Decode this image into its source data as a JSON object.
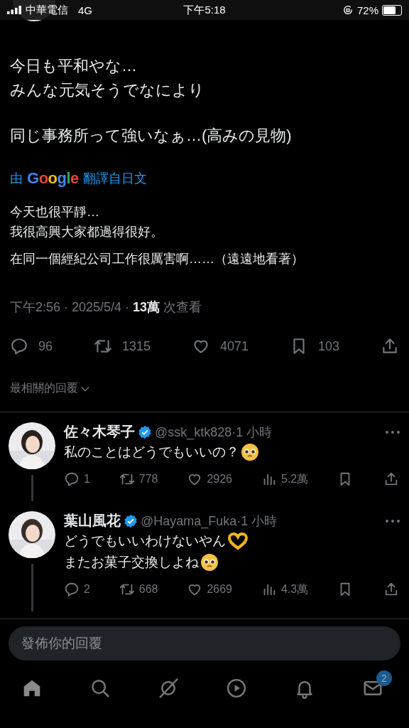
{
  "status_bar": {
    "carrier": "中華電信",
    "network": "4G",
    "time": "下午5:18",
    "battery": "72%"
  },
  "tweet": {
    "paragraphs": [
      "今日も平和やな…\nみんな元気そうでなにより",
      "同じ事務所って強いなぁ…(高みの見物)"
    ],
    "translation_prefix": "由",
    "translation_brand": "Google",
    "translation_suffix": "翻譯自日文",
    "translation_paragraphs": [
      "今天也很平靜…\n我很高興大家都過得很好。",
      "在同一個經紀公司工作很厲害啊……（遠遠地看著）"
    ],
    "meta": "下午2:56 · 2025/5/4 · **13萬** 次查看",
    "actions": [
      {
        "kind": "reply",
        "count": "96"
      },
      {
        "kind": "repost",
        "count": "1315"
      },
      {
        "kind": "like",
        "count": "4071"
      },
      {
        "kind": "bookmark",
        "count": "103"
      },
      {
        "kind": "share"
      }
    ]
  },
  "sort_label": "最相關的回覆",
  "replies": [
    {
      "name": "佐々木琴子",
      "handle_time": "@ssk_ktk828·1 小時",
      "verified": true,
      "lines": [
        [
          {
            "kind": "text",
            "text": "私のことはどうでもいいの？"
          },
          {
            "kind": "pleading"
          }
        ]
      ],
      "actions": [
        {
          "kind": "reply",
          "count": "1"
        },
        {
          "kind": "repost",
          "count": "778"
        },
        {
          "kind": "like",
          "count": "2926"
        },
        {
          "kind": "views",
          "count": "5.2萬"
        },
        {
          "kind": "bookmark"
        },
        {
          "kind": "share"
        }
      ]
    },
    {
      "name": "葉山風花",
      "handle_time": "@Hayama_Fuka·1 小時",
      "verified": true,
      "lines": [
        [
          {
            "kind": "text",
            "text": "どうでもいいわけないやん"
          },
          {
            "kind": "hearthands"
          }
        ],
        [
          {
            "kind": "text",
            "text": "またお菓子交換しよね"
          },
          {
            "kind": "pleading"
          }
        ]
      ],
      "actions": [
        {
          "kind": "reply",
          "count": "2"
        },
        {
          "kind": "repost",
          "count": "668"
        },
        {
          "kind": "like",
          "count": "2669"
        },
        {
          "kind": "views",
          "count": "4.3萬"
        },
        {
          "kind": "bookmark"
        },
        {
          "kind": "share"
        }
      ]
    }
  ],
  "reply_field": {
    "placeholder": "發佈你的回覆"
  },
  "tab_bar": [
    {
      "kind": "home",
      "selected": true
    },
    {
      "kind": "search",
      "selected": false
    },
    {
      "kind": "grok",
      "selected": false
    },
    {
      "kind": "video",
      "selected": false
    },
    {
      "kind": "notifications",
      "selected": false
    },
    {
      "kind": "messages",
      "selected": false,
      "badge": "2"
    }
  ]
}
